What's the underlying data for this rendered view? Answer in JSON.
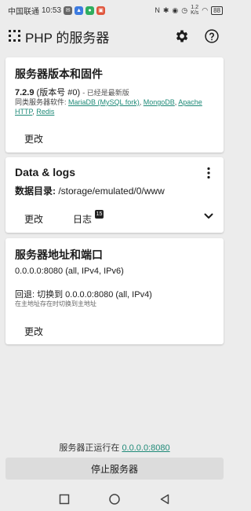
{
  "status_bar": {
    "carrier": "中国联通",
    "time": "10:53",
    "network_speed": "1.2",
    "network_speed_unit": "K/s",
    "battery": "88"
  },
  "app_bar": {
    "title": "PHP 的服务器",
    "icons": [
      "grid-icon",
      "settings-icon",
      "help-icon"
    ]
  },
  "version_card": {
    "title": "服务器版本和固件",
    "version": "7.2.9",
    "build": "(版本号 #0)",
    "status": " - 已经是最新版",
    "similar_label": "同类服务器软件: ",
    "similar_links": [
      "MariaDB (MySQL fork)",
      "MongoDB",
      "Apache HTTP",
      "Redis"
    ],
    "change_label": "更改"
  },
  "data_card": {
    "title": "Data & logs",
    "dir_label": "数据目录:",
    "dir_value": " /storage/emulated/0/www",
    "change_label": "更改",
    "logs_label": "日志",
    "logs_count": "15"
  },
  "address_card": {
    "title": "服务器地址和端口",
    "address": "0.0.0.0:8080 (all, IPv4, IPv6)",
    "fallback": "回退: 切换到 0.0.0.0:8080 (all, IPv4)",
    "fallback_note": "在主地址存在时切换到主地址",
    "change_label": "更改"
  },
  "footer": {
    "running_prefix": "服务器正运行在 ",
    "running_address": "0.0.0.0:8080",
    "stop_label": "停止服务器"
  },
  "colors": {
    "link": "#1f8a78",
    "background": "#ececec",
    "card": "#ffffff"
  }
}
